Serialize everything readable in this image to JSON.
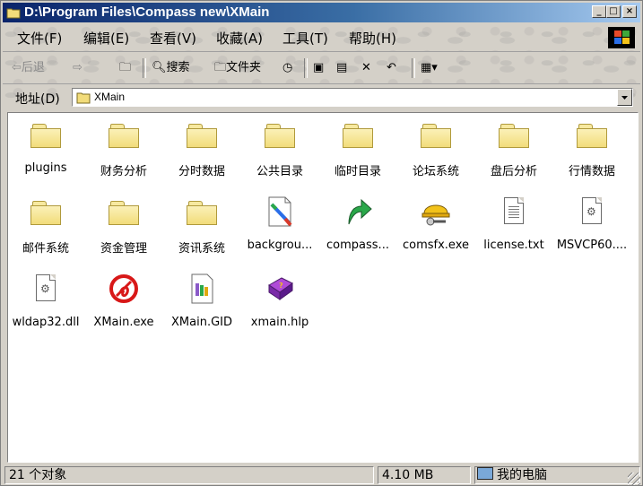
{
  "window": {
    "title": "D:\\Program Files\\Compass new\\XMain",
    "controls": {
      "minimize": "_",
      "maximize": "□",
      "close": "×"
    }
  },
  "menu": [
    {
      "label": "文件(F)"
    },
    {
      "label": "编辑(E)"
    },
    {
      "label": "查看(V)"
    },
    {
      "label": "收藏(A)"
    },
    {
      "label": "工具(T)"
    },
    {
      "label": "帮助(H)"
    }
  ],
  "toolbar": {
    "back": "后退",
    "search": "搜索",
    "folders": "文件夹"
  },
  "address": {
    "label": "地址(D)",
    "value": "XMain"
  },
  "items": [
    {
      "label": "plugins",
      "icon": "folder-icon"
    },
    {
      "label": "财务分析",
      "icon": "folder-icon"
    },
    {
      "label": "分时数据",
      "icon": "folder-icon"
    },
    {
      "label": "公共目录",
      "icon": "folder-icon"
    },
    {
      "label": "临时目录",
      "icon": "folder-icon"
    },
    {
      "label": "论坛系统",
      "icon": "folder-icon"
    },
    {
      "label": "盘后分析",
      "icon": "folder-icon"
    },
    {
      "label": "行情数据",
      "icon": "folder-icon"
    },
    {
      "label": "邮件系统",
      "icon": "folder-icon"
    },
    {
      "label": "资金管理",
      "icon": "folder-icon"
    },
    {
      "label": "资讯系统",
      "icon": "folder-icon"
    },
    {
      "label": "backgrou...",
      "icon": "image-file-icon"
    },
    {
      "label": "compass...",
      "icon": "shortcut-arrow-icon"
    },
    {
      "label": "comsfx.exe",
      "icon": "hardhat-icon"
    },
    {
      "label": "license.txt",
      "icon": "text-file-icon"
    },
    {
      "label": "MSVCP60....",
      "icon": "dll-file-icon"
    },
    {
      "label": "wldap32.dll",
      "icon": "dll-file-icon"
    },
    {
      "label": "XMain.exe",
      "icon": "xmain-logo-icon"
    },
    {
      "label": "XMain.GID",
      "icon": "gid-file-icon"
    },
    {
      "label": "xmain.hlp",
      "icon": "help-book-icon"
    }
  ],
  "status": {
    "count": "21 个对象",
    "size": "4.10 MB",
    "location": "我的电脑"
  }
}
